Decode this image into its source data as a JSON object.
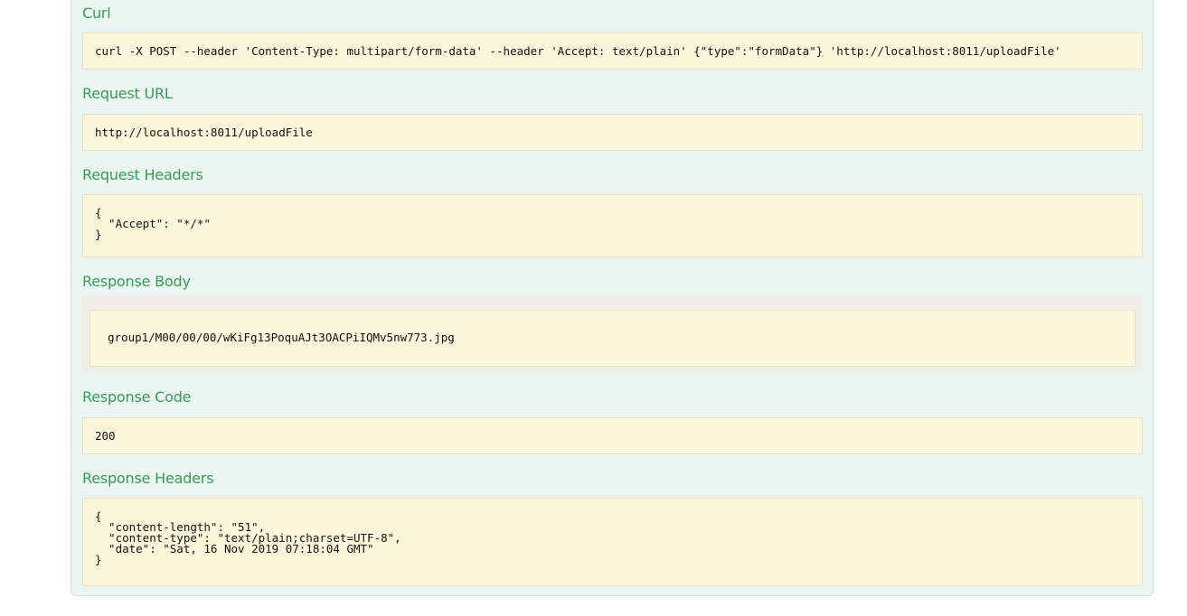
{
  "sections": {
    "curl": {
      "title": "Curl",
      "code": "curl -X POST --header 'Content-Type: multipart/form-data' --header 'Accept: text/plain' {\"type\":\"formData\"} 'http://localhost:8011/uploadFile'"
    },
    "request_url": {
      "title": "Request URL",
      "code": "http://localhost:8011/uploadFile"
    },
    "request_headers": {
      "title": "Request Headers",
      "code": "{\n  \"Accept\": \"*/*\"\n}"
    },
    "response_body": {
      "title": "Response Body",
      "code": "group1/M00/00/00/wKiFg13PoquAJt3OACPiIQMv5nw773.jpg"
    },
    "response_code": {
      "title": "Response Code",
      "code": "200"
    },
    "response_headers": {
      "title": "Response Headers",
      "code": "{\n  \"content-length\": \"51\",\n  \"content-type\": \"text/plain;charset=UTF-8\",\n  \"date\": \"Sat, 16 Nov 2019 07:18:04 GMT\"\n}"
    }
  },
  "colors": {
    "title_green": "#3a9b55",
    "panel_bg": "#ebf5f1",
    "code_bg": "#fcf6db"
  }
}
